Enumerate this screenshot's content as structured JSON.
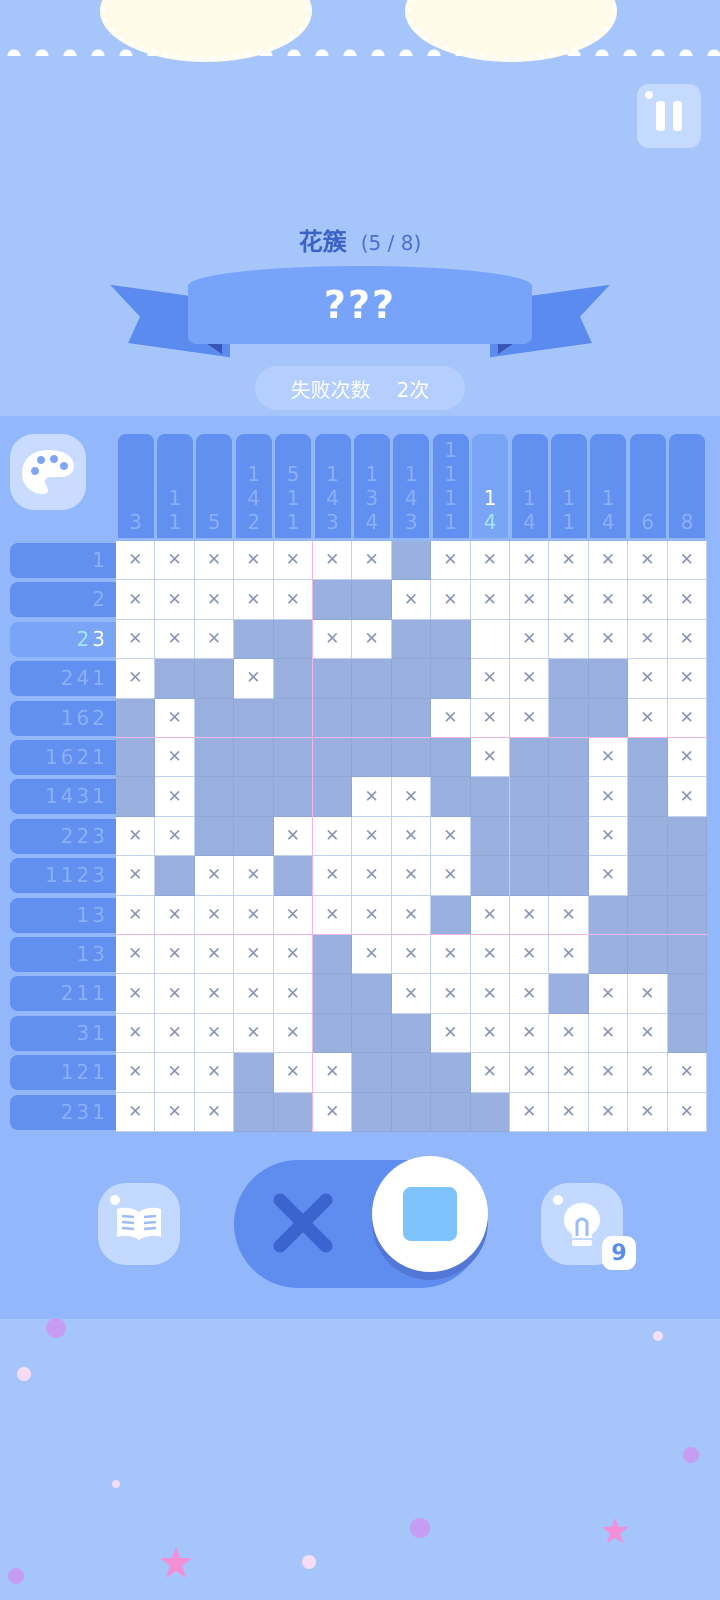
{
  "level": {
    "name": "花簇",
    "progress": "(5 / 8)"
  },
  "puzzle_name": "???",
  "failures": {
    "label": "失败次数",
    "value": "2次"
  },
  "grid": {
    "rows": 15,
    "cols": 15,
    "col_clues": [
      [
        "3"
      ],
      [
        "1",
        "1"
      ],
      [
        "5"
      ],
      [
        "1",
        "4",
        "2"
      ],
      [
        "5",
        "1",
        "1"
      ],
      [
        "1",
        "4",
        "3"
      ],
      [
        "1",
        "3",
        "4"
      ],
      [
        "1",
        "4",
        "3"
      ],
      [
        "1",
        "1",
        "1",
        "1"
      ],
      [
        "1",
        "4"
      ],
      [
        "1",
        "4"
      ],
      [
        "1",
        "1"
      ],
      [
        "1",
        "4"
      ],
      [
        "6"
      ],
      [
        "8"
      ]
    ],
    "row_clues": [
      [
        "1"
      ],
      [
        "2"
      ],
      [
        "2",
        "3"
      ],
      [
        "2",
        "4",
        "1"
      ],
      [
        "1",
        "6",
        "2"
      ],
      [
        "1",
        "6",
        "2",
        "1"
      ],
      [
        "1",
        "4",
        "3",
        "1"
      ],
      [
        "2",
        "2",
        "3"
      ],
      [
        "1",
        "1",
        "2",
        "3"
      ],
      [
        "1",
        "3"
      ],
      [
        "1",
        "3"
      ],
      [
        "2",
        "1",
        "1"
      ],
      [
        "3",
        "1"
      ],
      [
        "1",
        "2",
        "1"
      ],
      [
        "2",
        "3",
        "1"
      ]
    ],
    "active_row": 2,
    "active_col": 9,
    "cells": [
      "xxxxxxxfxxxxxxx",
      "xxxxxffxxxxxxxx",
      "xxxffxxffexxxxx",
      "xffxfffffxxffxxx",
      "fxffffffxxxffxx",
      "fxfffffffxffxfx",
      "fxffffxxffffxfx",
      "xxffxxxxxfffxfff",
      "xfxxfxxxxfffxfff",
      "xxxxxxxxfxxxfff",
      "xxxxxfxxxxxxfff",
      "xxxxxffxxxxfxxf",
      "xxxxxfffxxxxxxf",
      "xxxfxxfffxxxxxxf",
      "xxxffxffffxxxxxf"
    ]
  },
  "controls": {
    "book_icon": "book-icon",
    "mode_cross_icon": "cross-icon",
    "mode_fill_icon": "fill-square-icon",
    "hint_icon": "lightbulb-icon",
    "hint_count": "9"
  }
}
